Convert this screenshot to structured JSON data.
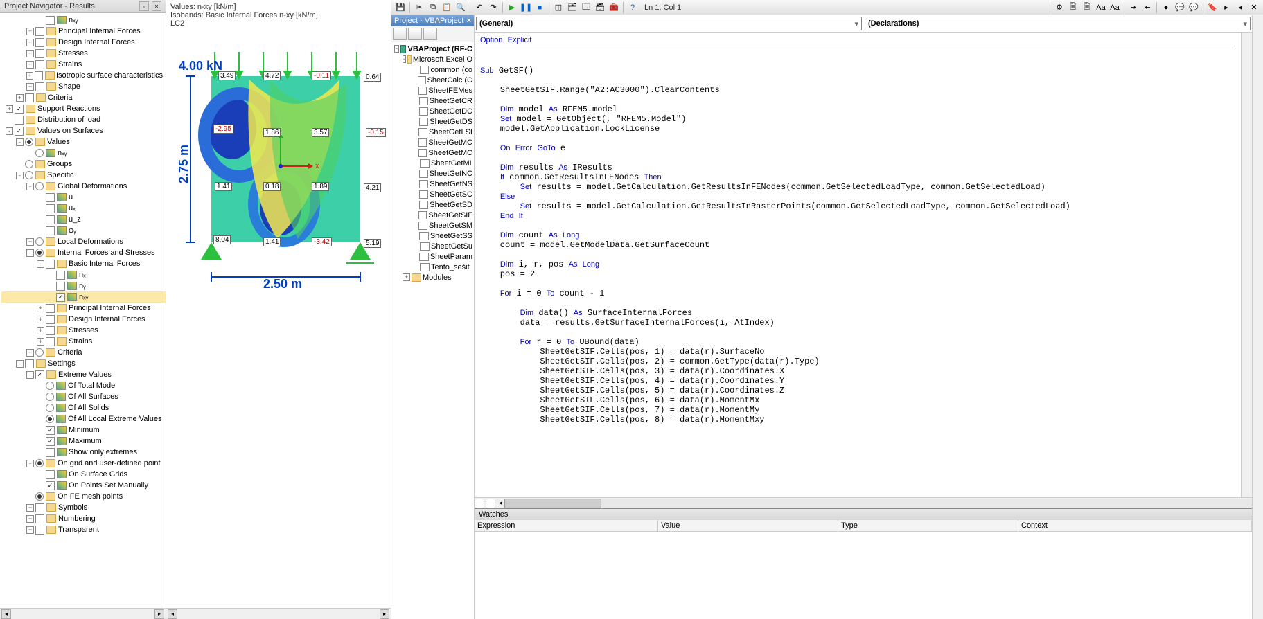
{
  "navigator": {
    "title": "Project Navigator - Results",
    "items": [
      {
        "indent": 3,
        "exp": "",
        "chk": false,
        "radio": false,
        "icon": "result",
        "label": "nₓᵧ"
      },
      {
        "indent": 2,
        "exp": "+",
        "chk": false,
        "radio": false,
        "icon": "cat",
        "label": "Principal Internal Forces"
      },
      {
        "indent": 2,
        "exp": "+",
        "chk": false,
        "radio": false,
        "icon": "cat",
        "label": "Design Internal Forces"
      },
      {
        "indent": 2,
        "exp": "+",
        "chk": false,
        "radio": false,
        "icon": "cat",
        "label": "Stresses"
      },
      {
        "indent": 2,
        "exp": "+",
        "chk": false,
        "radio": false,
        "icon": "cat",
        "label": "Strains"
      },
      {
        "indent": 2,
        "exp": "+",
        "chk": false,
        "radio": false,
        "icon": "cat",
        "label": "Isotropic surface characteristics"
      },
      {
        "indent": 2,
        "exp": "+",
        "chk": false,
        "radio": false,
        "icon": "cat",
        "label": "Shape"
      },
      {
        "indent": 1,
        "exp": "+",
        "chk": false,
        "radio": false,
        "icon": "cat",
        "label": "Criteria"
      },
      {
        "indent": 0,
        "exp": "+",
        "chk": true,
        "radio": false,
        "icon": "cat",
        "label": "Support Reactions"
      },
      {
        "indent": 0,
        "exp": "",
        "chk": false,
        "radio": false,
        "icon": "cat",
        "label": "Distribution of load"
      },
      {
        "indent": 0,
        "exp": "-",
        "chk": true,
        "radio": false,
        "icon": "cat",
        "label": "Values on Surfaces"
      },
      {
        "indent": 1,
        "exp": "-",
        "chk": false,
        "radio": "on",
        "icon": "folder",
        "label": "Values"
      },
      {
        "indent": 2,
        "exp": "",
        "chk": false,
        "radio": "off",
        "icon": "result",
        "label": "nₓᵧ"
      },
      {
        "indent": 1,
        "exp": "",
        "chk": false,
        "radio": "off",
        "icon": "folder",
        "label": "Groups"
      },
      {
        "indent": 1,
        "exp": "-",
        "chk": false,
        "radio": "off",
        "icon": "folder",
        "label": "Specific"
      },
      {
        "indent": 2,
        "exp": "-",
        "chk": false,
        "radio": "off",
        "icon": "folder",
        "label": "Global Deformations"
      },
      {
        "indent": 3,
        "exp": "",
        "chk": false,
        "radio": false,
        "icon": "result",
        "label": "u"
      },
      {
        "indent": 3,
        "exp": "",
        "chk": false,
        "radio": false,
        "icon": "result",
        "label": "uₓ"
      },
      {
        "indent": 3,
        "exp": "",
        "chk": false,
        "radio": false,
        "icon": "result",
        "label": "u_z"
      },
      {
        "indent": 3,
        "exp": "",
        "chk": false,
        "radio": false,
        "icon": "result",
        "label": "φᵧ"
      },
      {
        "indent": 2,
        "exp": "+",
        "chk": false,
        "radio": "off",
        "icon": "folder",
        "label": "Local Deformations"
      },
      {
        "indent": 2,
        "exp": "-",
        "chk": false,
        "radio": "on",
        "icon": "folder",
        "label": "Internal Forces and Stresses"
      },
      {
        "indent": 3,
        "exp": "-",
        "chk": false,
        "radio": false,
        "icon": "folder",
        "label": "Basic Internal Forces"
      },
      {
        "indent": 4,
        "exp": "",
        "chk": false,
        "radio": false,
        "icon": "result",
        "label": "nₓ"
      },
      {
        "indent": 4,
        "exp": "",
        "chk": false,
        "radio": false,
        "icon": "result",
        "label": "nᵧ"
      },
      {
        "indent": 4,
        "exp": "",
        "chk": true,
        "radio": false,
        "icon": "result",
        "label": "nₓᵧ",
        "hl": true
      },
      {
        "indent": 3,
        "exp": "+",
        "chk": false,
        "radio": false,
        "icon": "folder",
        "label": "Principal Internal Forces"
      },
      {
        "indent": 3,
        "exp": "+",
        "chk": false,
        "radio": false,
        "icon": "folder",
        "label": "Design Internal Forces"
      },
      {
        "indent": 3,
        "exp": "+",
        "chk": false,
        "radio": false,
        "icon": "folder",
        "label": "Stresses"
      },
      {
        "indent": 3,
        "exp": "+",
        "chk": false,
        "radio": false,
        "icon": "folder",
        "label": "Strains"
      },
      {
        "indent": 2,
        "exp": "+",
        "chk": false,
        "radio": "off",
        "icon": "folder",
        "label": "Criteria"
      },
      {
        "indent": 1,
        "exp": "-",
        "chk": false,
        "radio": false,
        "icon": "cat",
        "label": "Settings"
      },
      {
        "indent": 2,
        "exp": "-",
        "chk": true,
        "radio": false,
        "icon": "folder",
        "label": "Extreme Values"
      },
      {
        "indent": 3,
        "exp": "",
        "chk": false,
        "radio": "off",
        "icon": "result",
        "label": "Of Total Model"
      },
      {
        "indent": 3,
        "exp": "",
        "chk": false,
        "radio": "off",
        "icon": "result",
        "label": "Of All Surfaces"
      },
      {
        "indent": 3,
        "exp": "",
        "chk": false,
        "radio": "off",
        "icon": "result",
        "label": "Of All Solids"
      },
      {
        "indent": 3,
        "exp": "",
        "chk": false,
        "radio": "on",
        "icon": "result",
        "label": "Of All Local Extreme Values"
      },
      {
        "indent": 3,
        "exp": "",
        "chk": true,
        "radio": false,
        "icon": "result",
        "label": "Minimum"
      },
      {
        "indent": 3,
        "exp": "",
        "chk": true,
        "radio": false,
        "icon": "result",
        "label": "Maximum"
      },
      {
        "indent": 3,
        "exp": "",
        "chk": false,
        "radio": false,
        "icon": "result",
        "label": "Show only extremes"
      },
      {
        "indent": 2,
        "exp": "-",
        "chk": false,
        "radio": "on",
        "icon": "folder",
        "label": "On grid and user-defined point"
      },
      {
        "indent": 3,
        "exp": "",
        "chk": false,
        "radio": false,
        "icon": "result",
        "label": "On Surface Grids"
      },
      {
        "indent": 3,
        "exp": "",
        "chk": true,
        "radio": false,
        "icon": "result",
        "label": "On Points Set Manually"
      },
      {
        "indent": 2,
        "exp": "",
        "chk": false,
        "radio": "on",
        "icon": "folder",
        "label": "On FE mesh points"
      },
      {
        "indent": 2,
        "exp": "+",
        "chk": false,
        "radio": false,
        "icon": "folder",
        "label": "Symbols"
      },
      {
        "indent": 2,
        "exp": "+",
        "chk": false,
        "radio": false,
        "icon": "folder",
        "label": "Numbering"
      },
      {
        "indent": 2,
        "exp": "+",
        "chk": false,
        "radio": false,
        "icon": "folder",
        "label": "Transparent"
      }
    ]
  },
  "preview": {
    "line1": "Values: n-xy [kN/m]",
    "line2": "Isobands: Basic Internal Forces n-xy [kN/m]",
    "line3": "LC2",
    "load_label": "4.00 kN",
    "dim_x": "2.50 m",
    "dim_y": "2.75 m",
    "vals": [
      "3.49",
      "4.72",
      "-0.11",
      "0.64",
      "-2.95",
      "1.86",
      "3.57",
      "-0.15",
      "1.41",
      "0.18",
      "1.89",
      "4.21",
      "8.04",
      "1.41",
      "-3.42",
      "5.19"
    ]
  },
  "vba": {
    "position": "Ln 1, Col 1",
    "project_title": "Project - VBAProject",
    "project_tree": [
      {
        "indent": 0,
        "exp": "-",
        "icon": "proj",
        "label": "VBAProject (RF-C",
        "bold": true
      },
      {
        "indent": 1,
        "exp": "-",
        "icon": "fold",
        "label": "Microsoft Excel O"
      },
      {
        "indent": 2,
        "exp": "",
        "icon": "mod",
        "label": "common (co"
      },
      {
        "indent": 2,
        "exp": "",
        "icon": "mod",
        "label": "SheetCalc (C"
      },
      {
        "indent": 2,
        "exp": "",
        "icon": "mod",
        "label": "SheetFEMes"
      },
      {
        "indent": 2,
        "exp": "",
        "icon": "mod",
        "label": "SheetGetCR"
      },
      {
        "indent": 2,
        "exp": "",
        "icon": "mod",
        "label": "SheetGetDC"
      },
      {
        "indent": 2,
        "exp": "",
        "icon": "mod",
        "label": "SheetGetDS"
      },
      {
        "indent": 2,
        "exp": "",
        "icon": "mod",
        "label": "SheetGetLSI"
      },
      {
        "indent": 2,
        "exp": "",
        "icon": "mod",
        "label": "SheetGetMC"
      },
      {
        "indent": 2,
        "exp": "",
        "icon": "mod",
        "label": "SheetGetMC"
      },
      {
        "indent": 2,
        "exp": "",
        "icon": "mod",
        "label": "SheetGetMI"
      },
      {
        "indent": 2,
        "exp": "",
        "icon": "mod",
        "label": "SheetGetNC"
      },
      {
        "indent": 2,
        "exp": "",
        "icon": "mod",
        "label": "SheetGetNS"
      },
      {
        "indent": 2,
        "exp": "",
        "icon": "mod",
        "label": "SheetGetSC"
      },
      {
        "indent": 2,
        "exp": "",
        "icon": "mod",
        "label": "SheetGetSD"
      },
      {
        "indent": 2,
        "exp": "",
        "icon": "mod",
        "label": "SheetGetSIF"
      },
      {
        "indent": 2,
        "exp": "",
        "icon": "mod",
        "label": "SheetGetSM"
      },
      {
        "indent": 2,
        "exp": "",
        "icon": "mod",
        "label": "SheetGetSS"
      },
      {
        "indent": 2,
        "exp": "",
        "icon": "mod",
        "label": "SheetGetSu"
      },
      {
        "indent": 2,
        "exp": "",
        "icon": "mod",
        "label": "SheetParam"
      },
      {
        "indent": 2,
        "exp": "",
        "icon": "mod",
        "label": "Tento_sešit"
      },
      {
        "indent": 1,
        "exp": "+",
        "icon": "fold",
        "label": "Modules"
      }
    ],
    "dd_left": "(General)",
    "dd_right": "(Declarations)",
    "watches_title": "Watches",
    "watch_cols": [
      "Expression",
      "Value",
      "Type",
      "Context"
    ],
    "code": "Option Explicit\n\nSub GetSF()\n\n    SheetGetSIF.Range(\"A2:AC3000\").ClearContents\n\n    Dim model As RFEM5.model\n    Set model = GetObject(, \"RFEM5.Model\")\n    model.GetApplication.LockLicense\n\n    On Error GoTo e\n\n    Dim results As IResults\n    If common.GetResultsInFENodes Then\n        Set results = model.GetCalculation.GetResultsInFENodes(common.GetSelectedLoadType, common.GetSelectedLoad)\n    Else\n        Set results = model.GetCalculation.GetResultsInRasterPoints(common.GetSelectedLoadType, common.GetSelectedLoad)\n    End If\n\n    Dim count As Long\n    count = model.GetModelData.GetSurfaceCount\n\n    Dim i, r, pos As Long\n    pos = 2\n\n    For i = 0 To count - 1\n\n        Dim data() As SurfaceInternalForces\n        data = results.GetSurfaceInternalForces(i, AtIndex)\n\n        For r = 0 To UBound(data)\n            SheetGetSIF.Cells(pos, 1) = data(r).SurfaceNo\n            SheetGetSIF.Cells(pos, 2) = common.GetType(data(r).Type)\n            SheetGetSIF.Cells(pos, 3) = data(r).Coordinates.X\n            SheetGetSIF.Cells(pos, 4) = data(r).Coordinates.Y\n            SheetGetSIF.Cells(pos, 5) = data(r).Coordinates.Z\n            SheetGetSIF.Cells(pos, 6) = data(r).MomentMx\n            SheetGetSIF.Cells(pos, 7) = data(r).MomentMy\n            SheetGetSIF.Cells(pos, 8) = data(r).MomentMxy"
  }
}
